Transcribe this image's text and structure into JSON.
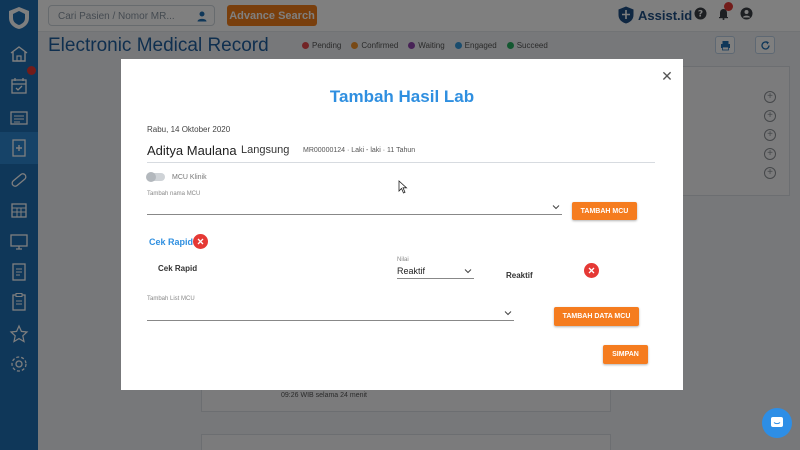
{
  "topbar": {
    "search_placeholder": "Cari Pasien / Nomor MR...",
    "advance_search_label": "Advance Search",
    "brand_name": "Assist.id"
  },
  "page": {
    "title": "Electronic Medical Record",
    "legend": [
      {
        "label": "Pending",
        "color": "#e5484d"
      },
      {
        "label": "Confirmed",
        "color": "#f0932b"
      },
      {
        "label": "Waiting",
        "color": "#8e44ad"
      },
      {
        "label": "Engaged",
        "color": "#3498db"
      },
      {
        "label": "Succeed",
        "color": "#27ae60"
      }
    ]
  },
  "background": {
    "card_time_text": "09:26 WIB selama 24 menit"
  },
  "modal": {
    "title": "Tambah Hasil Lab",
    "date": "Rabu, 14 Oktober 2020",
    "patient_name": "Aditya Maulana",
    "visit_type": "Langsung",
    "patient_info": "MR00000124 · Laki - laki · 11 Tahun",
    "toggle_label": "MCU Klinik",
    "mcu_name_label": "Tambah nama MCU",
    "tambah_mcu_button": "TAMBAH MCU",
    "section_title": "Cek Rapid",
    "row_label": "Cek Rapid",
    "nilai_label": "Nilai",
    "nilai_value": "Reaktif",
    "result_text": "Reaktif",
    "list_mcu_label": "Tambah List MCU",
    "tambah_data_button": "TAMBAH DATA MCU",
    "save_button": "SIMPAN"
  },
  "colors": {
    "primary_blue": "#1f6eb3",
    "accent_orange": "#f57c1f",
    "title_blue": "#2f8fe0",
    "danger_red": "#e53935"
  }
}
